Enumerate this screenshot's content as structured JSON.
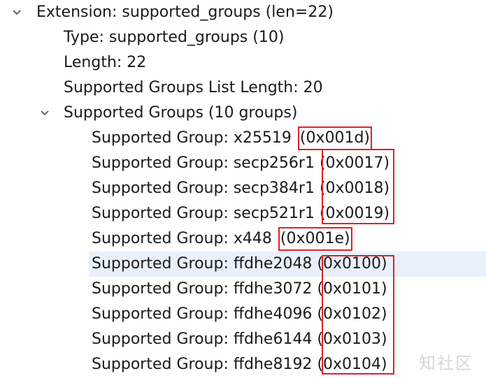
{
  "tree": {
    "extension": {
      "label": "Extension: supported_groups (len=22)"
    },
    "type": {
      "label": "Type: supported_groups (10)"
    },
    "length": {
      "label": "Length: 22"
    },
    "list_length": {
      "label": "Supported Groups List Length: 20"
    },
    "groups_node": {
      "label": "Supported Groups (10 groups)"
    },
    "groups": [
      {
        "name": "Supported Group: x25519",
        "code": "(0x001d)"
      },
      {
        "name": "Supported Group: secp256r1",
        "code": "(0x0017)"
      },
      {
        "name": "Supported Group: secp384r1",
        "code": "(0x0018)"
      },
      {
        "name": "Supported Group: secp521r1",
        "code": "(0x0019)"
      },
      {
        "name": "Supported Group: x448",
        "code": "(0x001e)"
      },
      {
        "name": "Supported Group: ffdhe2048",
        "code": "(0x0100)"
      },
      {
        "name": "Supported Group: ffdhe3072",
        "code": "(0x0101)"
      },
      {
        "name": "Supported Group: ffdhe4096",
        "code": "(0x0102)"
      },
      {
        "name": "Supported Group: ffdhe6144",
        "code": "(0x0103)"
      },
      {
        "name": "Supported Group: ffdhe8192",
        "code": "(0x0104)"
      }
    ]
  },
  "watermark": "知社区",
  "colors": {
    "highlight_border": "#e0202a",
    "selected_row": "#e8f1fb"
  }
}
